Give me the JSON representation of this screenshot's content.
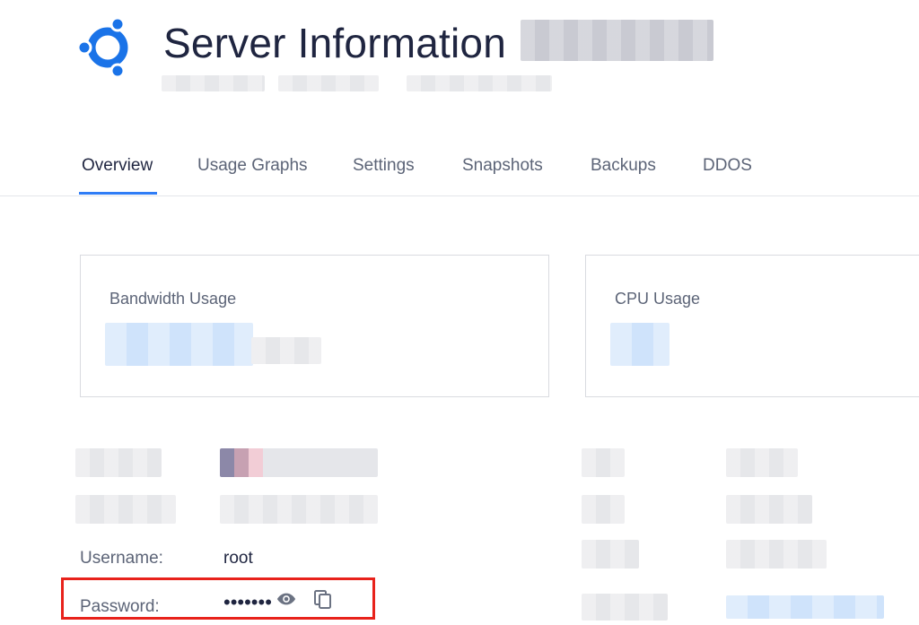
{
  "header": {
    "title": "Server Information",
    "logo": "ubuntu-logo-icon"
  },
  "tabs": [
    {
      "label": "Overview",
      "active": true
    },
    {
      "label": "Usage Graphs",
      "active": false
    },
    {
      "label": "Settings",
      "active": false
    },
    {
      "label": "Snapshots",
      "active": false
    },
    {
      "label": "Backups",
      "active": false
    },
    {
      "label": "DDOS",
      "active": false
    }
  ],
  "cards": {
    "bandwidth": {
      "title": "Bandwidth Usage"
    },
    "cpu": {
      "title": "CPU Usage"
    }
  },
  "details": {
    "username": {
      "label": "Username:",
      "value": "root"
    },
    "password": {
      "label": "Password:",
      "masked": "•••••••",
      "reveal_icon": "eye-icon",
      "copy_icon": "copy-icon"
    }
  },
  "colors": {
    "accent": "#2f7df6",
    "brand": "#1a73e8",
    "highlight": "#e8221b"
  }
}
